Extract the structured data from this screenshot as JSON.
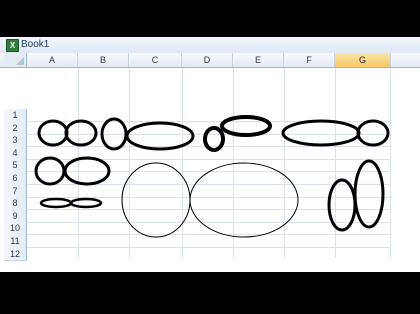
{
  "workbook": {
    "title": "Book1",
    "icon": "excel-workbook-icon"
  },
  "columns": [
    "A",
    "B",
    "C",
    "D",
    "E",
    "F",
    "G"
  ],
  "selected_column": "G",
  "rows": [
    "1",
    "2",
    "3",
    "4",
    "5",
    "6",
    "7",
    "8",
    "9",
    "10",
    "11",
    "12"
  ],
  "colors": {
    "selected_header": "#f6c766",
    "grid": "#d9e1ec",
    "header": "#e4ebf4"
  }
}
